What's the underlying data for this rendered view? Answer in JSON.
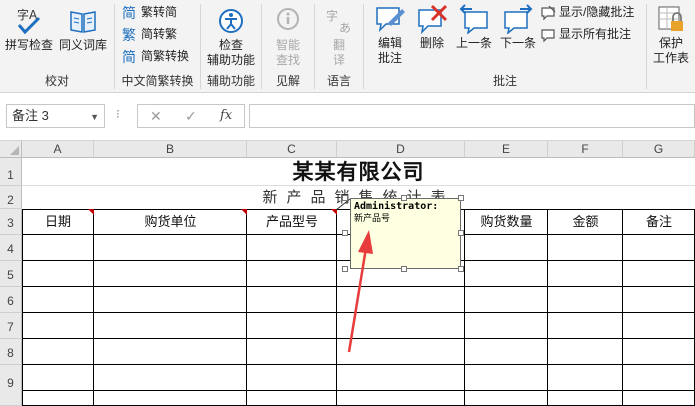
{
  "ribbon": {
    "proofing": {
      "spell_check": "拼写检查",
      "thesaurus": "同义词库",
      "label": "校对"
    },
    "chinese_conversion": {
      "to_traditional": "简转繁",
      "to_simplified": "繁转简",
      "convert": "简繁转换",
      "label": "中文简繁转换"
    },
    "tools": {
      "check_line1": "检查",
      "check_line2": "辅助功能",
      "label": "辅助功能"
    },
    "insights": {
      "smart_line1": "智能",
      "smart_line2": "查找",
      "label": "见解"
    },
    "language": {
      "translate_line1": "翻",
      "translate_line2": "译",
      "label": "语言"
    },
    "comments": {
      "edit_line1": "编辑",
      "edit_line2": "批注",
      "delete": "删除",
      "previous": "上一条",
      "next": "下一条",
      "show_hide": "显示/隐藏批注",
      "show_all": "显示所有批注",
      "label": "批注"
    },
    "protect": {
      "line1": "保护",
      "line2": "工作表"
    }
  },
  "formula_bar": {
    "name_box": "备注 3",
    "dropdown_icon": "▼",
    "dots": "⁝",
    "cancel": "✕",
    "enter": "✓",
    "function": "fx",
    "value": ""
  },
  "grid": {
    "columns": [
      "A",
      "B",
      "C",
      "D",
      "E",
      "F",
      "G"
    ],
    "rows": [
      "1",
      "2",
      "3",
      "4",
      "5",
      "6",
      "7",
      "8",
      "9"
    ],
    "title": "某某有限公司",
    "subtitle": "新产品销售统计表",
    "headers": {
      "A": "日期",
      "B": "购货单位",
      "C": "产品型号",
      "E": "购货数量",
      "F": "金额",
      "G": "备注"
    }
  },
  "comment": {
    "author": "Administrator:",
    "text": "新产品号"
  },
  "colors": {
    "accent": "#1e6fbf",
    "delete_red": "#d8332a",
    "comment_bg": "#ffffe1",
    "arrow": "#e83c3c",
    "indicator": "#c00000"
  }
}
